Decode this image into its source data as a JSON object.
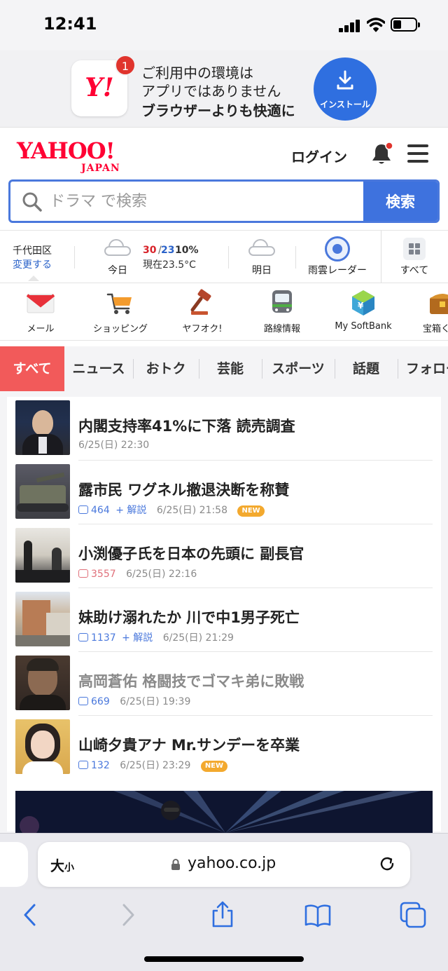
{
  "status_bar": {
    "time": "12:41",
    "battery_level": 0.35
  },
  "app_banner": {
    "app_icon_text": "Y!",
    "badge_count": "1",
    "line1": "ご利用中の環境は",
    "line2": "アプリではありません",
    "line3": "ブラウザーよりも快適に",
    "install_label": "インストール"
  },
  "header": {
    "logo": "YAHOO!",
    "logo_sub": "JAPAN",
    "login_label": "ログイン"
  },
  "search": {
    "placeholder": "ドラマ で検索",
    "button_label": "検索"
  },
  "weather": {
    "location": "千代田区",
    "change_label": "変更する",
    "today_label": "今日",
    "high": "30",
    "sep": "/",
    "low": "23",
    "rain": "10%",
    "current": "現在23.5°C",
    "tomorrow_label": "明日",
    "radar_label": "雨雲レーダー",
    "all_label": "すべて"
  },
  "services": [
    {
      "label": "メール",
      "icon": "mail-icon"
    },
    {
      "label": "ショッピング",
      "icon": "shopping-cart-icon"
    },
    {
      "label": "ヤフオク!",
      "icon": "auction-gavel-icon"
    },
    {
      "label": "路線情報",
      "icon": "train-icon"
    },
    {
      "label": "My SoftBank",
      "icon": "softbank-icon"
    },
    {
      "label": "宝箱くじ",
      "icon": "treasure-box-icon"
    }
  ],
  "tabs": [
    "すべて",
    "ニュース",
    "おトク",
    "芸能",
    "スポーツ",
    "話題",
    "フォロー"
  ],
  "news": [
    {
      "title": "内閣支持率41%に下落 読売調査",
      "comments": "",
      "kaisetsu": "",
      "date": "6/25(日) 22:30",
      "new": ""
    },
    {
      "title": "露市民 ワグネル撤退決断を称賛",
      "comments": "464",
      "kaisetsu": "+ 解説",
      "date": "6/25(日) 21:58",
      "new": "NEW"
    },
    {
      "title": "小渕優子氏を日本の先頭に 副長官",
      "comments": "3557",
      "kaisetsu": "",
      "date": "6/25(日) 22:16",
      "new": ""
    },
    {
      "title": "妹助け溺れたか 川で中1男子死亡",
      "comments": "1137",
      "kaisetsu": "+ 解説",
      "date": "6/25(日) 21:29",
      "new": ""
    },
    {
      "title": "高岡蒼佑 格闘技でゴマキ弟に敗戦",
      "comments": "669",
      "kaisetsu": "",
      "date": "6/25(日) 19:39",
      "new": ""
    },
    {
      "title": "山崎夕貴アナ Mr.サンデーを卒業",
      "comments": "132",
      "kaisetsu": "",
      "date": "6/25(日) 23:29",
      "new": "NEW"
    }
  ],
  "browser": {
    "aa_big": "大",
    "aa_small": "小",
    "url": "yahoo.co.jp"
  },
  "colors": {
    "accent_blue": "#3e72de",
    "brand_red": "#ff0033",
    "active_tab": "#f25a5a",
    "new_badge": "#f3a92e"
  }
}
